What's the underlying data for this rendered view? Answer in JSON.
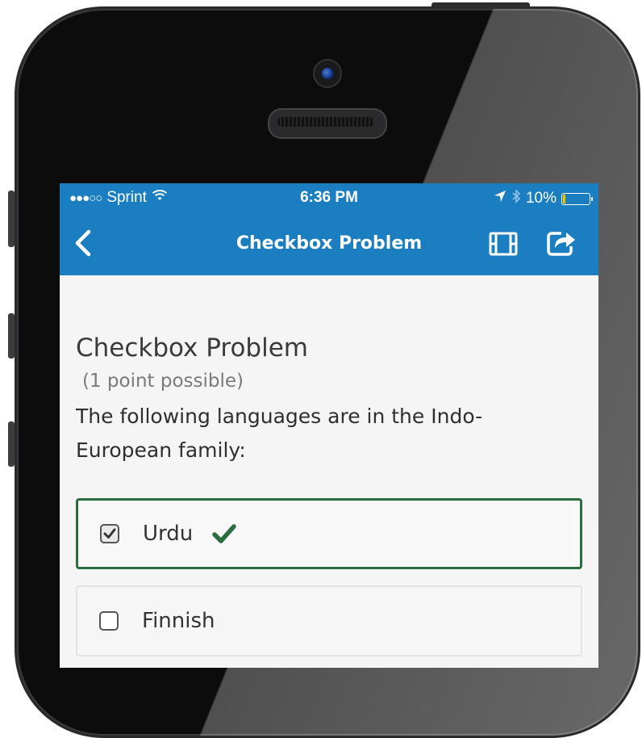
{
  "status_bar": {
    "signal": "●●●○○",
    "carrier": "Sprint",
    "time": "6:36 PM",
    "battery_text": "10%",
    "battery_level": 0.1,
    "icons": [
      "wifi-icon",
      "location-arrow-icon",
      "bluetooth-icon",
      "battery-icon"
    ]
  },
  "navbar": {
    "title": "Checkbox Problem",
    "icons": [
      "back-chevron-icon",
      "video-film-icon",
      "share-icon"
    ],
    "color": "#1a7ec0"
  },
  "problem": {
    "title": "Checkbox Problem",
    "points": "(1 point possible)",
    "question": "The following languages are in the Indo-European family:"
  },
  "options": [
    {
      "label": "Urdu",
      "checked": true,
      "correct": true
    },
    {
      "label": "Finnish",
      "checked": false
    }
  ],
  "colors": {
    "correct": "#2a6e3f",
    "accent": "#1a7ec0"
  }
}
